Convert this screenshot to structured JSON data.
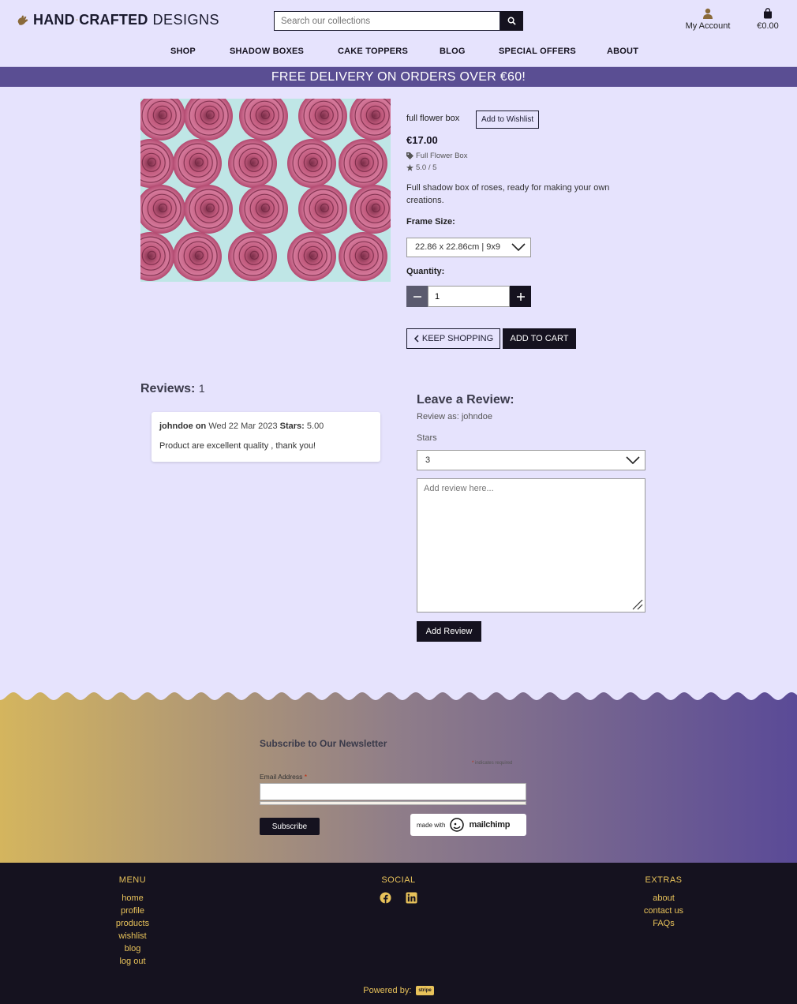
{
  "brand": {
    "logo_bold": "HAND",
    "logo_bold2": "CRAFTED",
    "logo_dash": "-",
    "logo_light": "DESIGNS"
  },
  "search": {
    "placeholder": "Search our collections"
  },
  "account": {
    "label": "My Account"
  },
  "cart": {
    "total": "€0.00"
  },
  "nav": [
    "SHOP",
    "SHADOW BOXES",
    "CAKE TOPPERS",
    "BLOG",
    "SPECIAL OFFERS",
    "ABOUT"
  ],
  "banner": "FREE DELIVERY ON ORDERS OVER €60!",
  "product": {
    "name": "full flower box",
    "wishlist_label": "Add to Wishlist",
    "price": "€17.00",
    "category": "Full Flower Box",
    "rating": "5.0 / 5",
    "description": "Full shadow box of roses, ready for making your own creations.",
    "frame_size_label": "Frame Size:",
    "frame_size_value": "22.86 x 22.86cm | 9x9",
    "quantity_label": "Quantity:",
    "quantity_value": "1",
    "keep_shopping": "KEEP SHOPPING",
    "add_to_cart": "ADD TO CART"
  },
  "reviews": {
    "title": "Reviews:",
    "count": "1",
    "items": [
      {
        "author": "johndoe on",
        "date": "Wed 22 Mar 2023",
        "stars_label": "Stars:",
        "stars": "5.00",
        "text": "Product are excellent quality , thank you!"
      }
    ]
  },
  "leave_review": {
    "title": "Leave a Review:",
    "review_as": "Review as: johndoe",
    "stars_label": "Stars",
    "stars_value": "3",
    "textarea_placeholder": "Add review here...",
    "submit": "Add Review"
  },
  "newsletter": {
    "title": "Subscribe to Our Newsletter",
    "required_note": "indicates required",
    "asterisk": "*",
    "email_label": "Email Address",
    "subscribe": "Subscribe",
    "made_with": "made with",
    "mailchimp": "mailchimp"
  },
  "footer": {
    "menu_title": "MENU",
    "menu": [
      "home",
      "profile",
      "products",
      "wishlist",
      "blog",
      "log out"
    ],
    "social_title": "SOCIAL",
    "social_icons": [
      "facebook-icon",
      "linkedin-icon"
    ],
    "extras_title": "EXTRAS",
    "extras": [
      "about",
      "contact us",
      "FAQs"
    ],
    "powered_by": "Powered by:",
    "stripe": "stripe"
  },
  "colors": {
    "page_bg": "#e6e3fd",
    "banner": "#5a4e93",
    "dark": "#15121f",
    "gold": "#e8c25a",
    "gradient_left": "#d4b55e",
    "gradient_right": "#5a4a97"
  }
}
